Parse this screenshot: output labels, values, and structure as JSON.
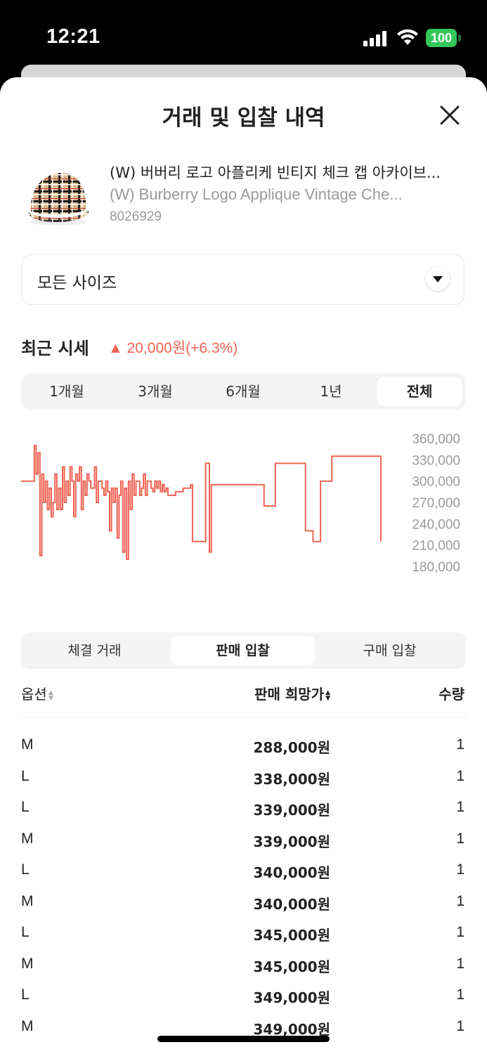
{
  "status_bar": {
    "time": "12:21",
    "battery": "100"
  },
  "sheet": {
    "title": "거래 및 입찰 내역"
  },
  "product": {
    "name_ko": "(W) 버버리 로고 아플리케 빈티지 체크 캡 아카이브...",
    "name_en": "(W) Burberry Logo Applique Vintage Che...",
    "code": "8026929"
  },
  "size_select": {
    "value": "모든 사이즈"
  },
  "recent_price": {
    "label": "최근 시세",
    "change": "▲ 20,000원(+6.3%)",
    "change_color": "#ef6253"
  },
  "period_tabs": [
    "1개월",
    "3개월",
    "6개월",
    "1년",
    "전체"
  ],
  "period_active": "전체",
  "chart_data": {
    "type": "line",
    "color": "#ef6253",
    "y_ticks": [
      "360,000",
      "330,000",
      "300,000",
      "270,000",
      "240,000",
      "210,000",
      "180,000"
    ],
    "ylim": [
      180000,
      360000
    ],
    "x_range": [
      0,
      100
    ],
    "points": [
      [
        0,
        300000
      ],
      [
        3,
        300000
      ],
      [
        3.5,
        350000
      ],
      [
        4,
        310000
      ],
      [
        4.5,
        340000
      ],
      [
        5,
        195000
      ],
      [
        5.5,
        310000
      ],
      [
        6,
        270000
      ],
      [
        6.5,
        300000
      ],
      [
        7,
        260000
      ],
      [
        7.5,
        290000
      ],
      [
        8,
        250000
      ],
      [
        8.5,
        270000
      ],
      [
        9,
        310000
      ],
      [
        9.5,
        260000
      ],
      [
        10,
        290000
      ],
      [
        10.5,
        260000
      ],
      [
        11,
        320000
      ],
      [
        11.5,
        270000
      ],
      [
        12,
        300000
      ],
      [
        12.5,
        280000
      ],
      [
        13,
        320000
      ],
      [
        13.5,
        300000
      ],
      [
        14,
        250000
      ],
      [
        14.5,
        310000
      ],
      [
        15,
        300000
      ],
      [
        15.5,
        320000
      ],
      [
        16,
        260000
      ],
      [
        16.5,
        300000
      ],
      [
        17,
        280000
      ],
      [
        17.5,
        310000
      ],
      [
        18,
        300000
      ],
      [
        18.5,
        290000
      ],
      [
        19,
        290000
      ],
      [
        19.5,
        320000
      ],
      [
        20,
        270000
      ],
      [
        20.5,
        300000
      ],
      [
        21,
        300000
      ],
      [
        21.5,
        290000
      ],
      [
        22,
        280000
      ],
      [
        22.5,
        300000
      ],
      [
        23,
        285000
      ],
      [
        23.5,
        230000
      ],
      [
        24,
        290000
      ],
      [
        24.5,
        270000
      ],
      [
        25,
        290000
      ],
      [
        25.5,
        220000
      ],
      [
        26,
        280000
      ],
      [
        26.5,
        300000
      ],
      [
        27,
        200000
      ],
      [
        27.5,
        290000
      ],
      [
        28,
        190000
      ],
      [
        28.5,
        300000
      ],
      [
        29,
        260000
      ],
      [
        29.5,
        310000
      ],
      [
        30,
        280000
      ],
      [
        30.5,
        300000
      ],
      [
        31,
        300000
      ],
      [
        31.5,
        280000
      ],
      [
        32,
        290000
      ],
      [
        32.5,
        310000
      ],
      [
        33,
        280000
      ],
      [
        33.5,
        300000
      ],
      [
        34,
        300000
      ],
      [
        34.5,
        290000
      ],
      [
        35,
        285000
      ],
      [
        35.5,
        300000
      ],
      [
        36,
        290000
      ],
      [
        36.5,
        300000
      ],
      [
        37,
        285000
      ],
      [
        37.5,
        295000
      ],
      [
        38,
        285000
      ],
      [
        38.5,
        290000
      ],
      [
        39,
        280000
      ],
      [
        40,
        280000
      ],
      [
        41,
        285000
      ],
      [
        42,
        285000
      ],
      [
        43,
        290000
      ],
      [
        44,
        290000
      ],
      [
        45,
        295000
      ],
      [
        45.5,
        215000
      ],
      [
        48.5,
        215000
      ],
      [
        49,
        325000
      ],
      [
        49.5,
        325000
      ],
      [
        50,
        200000
      ],
      [
        50.5,
        295000
      ],
      [
        64,
        295000
      ],
      [
        64.5,
        265000
      ],
      [
        67,
        265000
      ],
      [
        67.5,
        325000
      ],
      [
        75,
        325000
      ],
      [
        75.5,
        230000
      ],
      [
        77,
        230000
      ],
      [
        77.5,
        215000
      ],
      [
        79,
        215000
      ],
      [
        79.5,
        300000
      ],
      [
        82,
        300000
      ],
      [
        82.5,
        335000
      ],
      [
        95,
        335000
      ],
      [
        95.5,
        215000
      ]
    ]
  },
  "trade_tabs": [
    "체결 거래",
    "판매 입찰",
    "구매 입찰"
  ],
  "trade_active": "판매 입찰",
  "table": {
    "headers": {
      "option": "옵션",
      "price": "판매 희망가",
      "qty": "수량"
    },
    "rows": [
      {
        "option": "M",
        "price": "288,000원",
        "qty": "1"
      },
      {
        "option": "L",
        "price": "338,000원",
        "qty": "1"
      },
      {
        "option": "L",
        "price": "339,000원",
        "qty": "1"
      },
      {
        "option": "M",
        "price": "339,000원",
        "qty": "1"
      },
      {
        "option": "L",
        "price": "340,000원",
        "qty": "1"
      },
      {
        "option": "M",
        "price": "340,000원",
        "qty": "1"
      },
      {
        "option": "L",
        "price": "345,000원",
        "qty": "1"
      },
      {
        "option": "M",
        "price": "345,000원",
        "qty": "1"
      },
      {
        "option": "L",
        "price": "349,000원",
        "qty": "1"
      },
      {
        "option": "M",
        "price": "349,000원",
        "qty": "1"
      }
    ]
  }
}
